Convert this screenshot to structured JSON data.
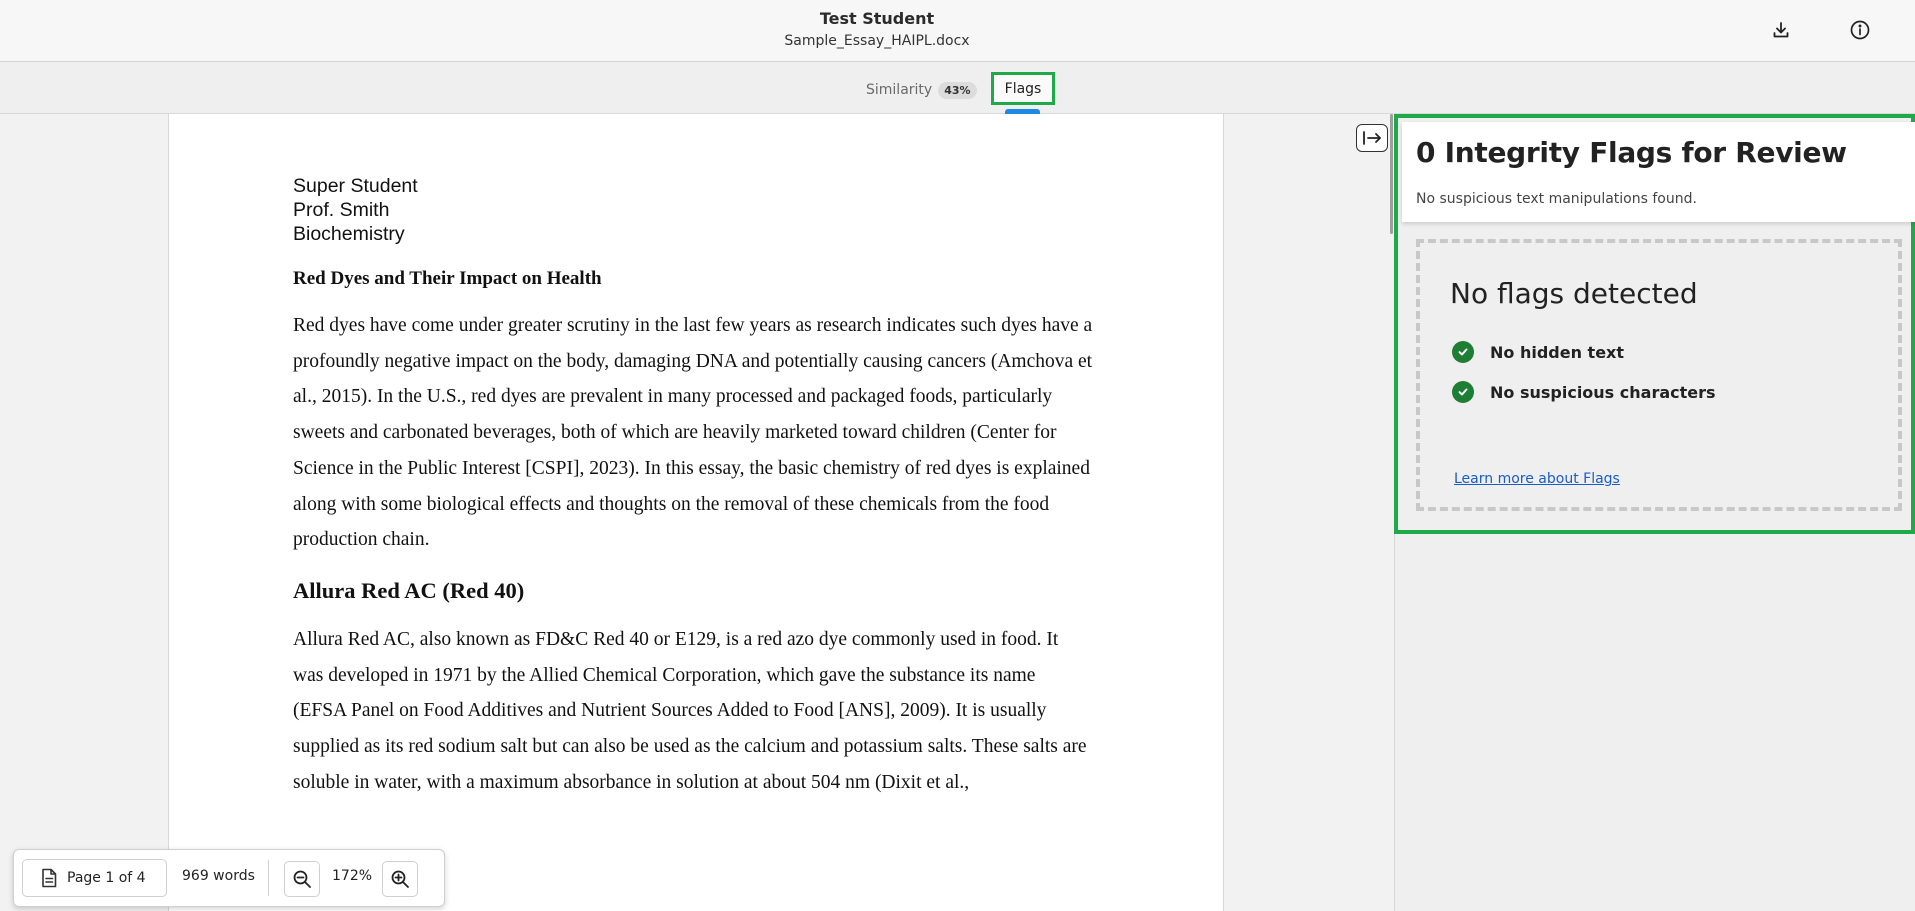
{
  "header": {
    "title": "Test Student",
    "filename": "Sample_Essay_HAIPL.docx"
  },
  "tabs": {
    "similarity_label": "Similarity",
    "similarity_score": "43%",
    "flags_label": "Flags"
  },
  "document": {
    "header_lines": [
      "Super Student",
      "Prof. Smith",
      "Biochemistry"
    ],
    "title": "Red Dyes and Their Impact on Health",
    "paragraph1": "Red dyes have come under greater scrutiny in the last few years as research indicates such dyes have a profoundly negative impact on the body, damaging DNA and potentially causing cancers (Amchova et al., 2015). In the U.S., red dyes are prevalent in many processed and packaged foods, particularly sweets and carbonated beverages, both of which are heavily marketed toward children (Center for Science in the Public Interest [CSPI], 2023). In this essay, the basic chemistry of red dyes is explained along with some biological effects and thoughts on the removal of these chemicals from the food production chain.",
    "section_heading": "Allura Red AC (Red 40)",
    "paragraph2": "Allura Red AC, also known as FD&C Red 40 or E129, is a red azo dye commonly used in food. It was developed in 1971 by the Allied Chemical Corporation, which gave the substance its name (EFSA Panel on Food Additives and Nutrient Sources Added to Food [ANS], 2009). It is usually supplied as its red sodium salt but can also be used as the calcium and potassium salts. These salts are soluble in water, with a maximum absorbance in solution at about 504 nm (Dixit et al.,"
  },
  "toolbar": {
    "page_label": "Page 1 of 4",
    "words_label": "969 words",
    "zoom_level": "172%"
  },
  "panel": {
    "heading": "0 Integrity Flags for Review",
    "subheading": "No suspicious text manipulations found.",
    "empty_title": "No flags detected",
    "checks": [
      "No hidden text",
      "No suspicious characters"
    ],
    "learn_more": "Learn more about Flags"
  },
  "colors": {
    "accent_green": "#1faa4a",
    "check_green": "#1e7e34",
    "tab_indicator": "#1e88e5",
    "link": "#1a5cc8"
  }
}
